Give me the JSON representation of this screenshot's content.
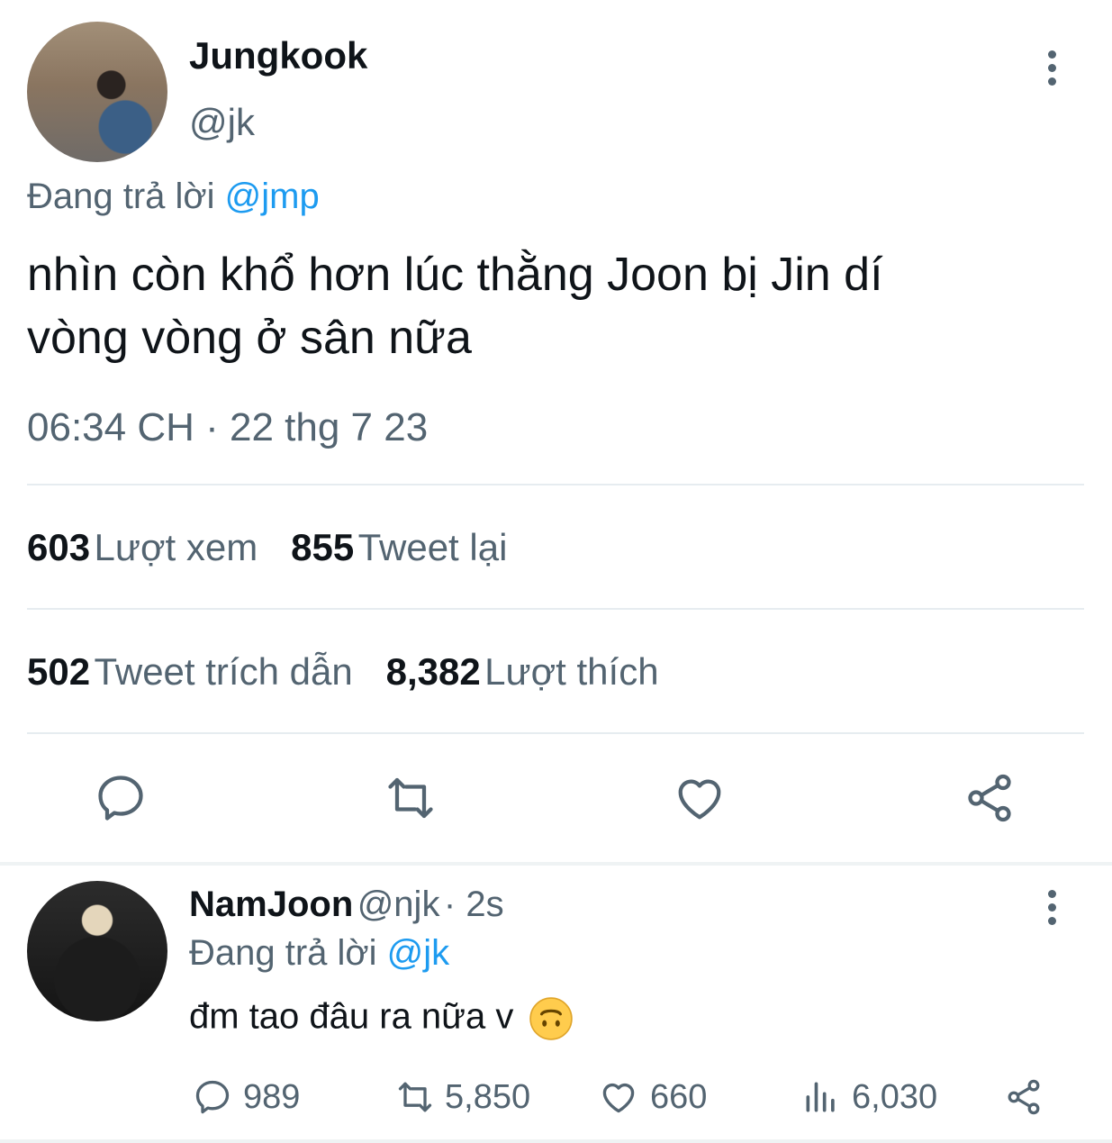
{
  "main_tweet": {
    "author_name": "Jungkook",
    "author_handle": "@jk",
    "replying_prefix": "Đang trả lời",
    "replying_to": "@jmp",
    "text_line1": "nhìn còn khổ hơn lúc thằng Joon bị Jin dí",
    "text_line2": "vòng vòng ở sân nữa",
    "timestamp": "06:34 CH · 22 thg 7 23",
    "stats": {
      "views_count": "603",
      "views_label": "Lượt xem",
      "retweets_count": "855",
      "retweets_label": "Tweet lại",
      "quotes_count": "502",
      "quotes_label": "Tweet trích dẫn",
      "likes_count": "8,382",
      "likes_label": "Lượt thích"
    },
    "actions": [
      "reply-icon",
      "retweet-icon",
      "heart-icon",
      "share-icon"
    ]
  },
  "reply_tweet": {
    "author_name": "NamJoon",
    "author_handle": "@njk",
    "time": "· 2s",
    "replying_prefix": "Đang trả lời",
    "replying_to": "@jk",
    "text": "đm tao đâu ra nữa v",
    "emoji": "🙃",
    "replies": "989",
    "retweets": "5,850",
    "likes": "660",
    "views": "6,030"
  },
  "colors": {
    "accent": "#1d9bf0",
    "text": "#0f1419",
    "muted": "#536471",
    "divider": "#e6ecf0"
  }
}
